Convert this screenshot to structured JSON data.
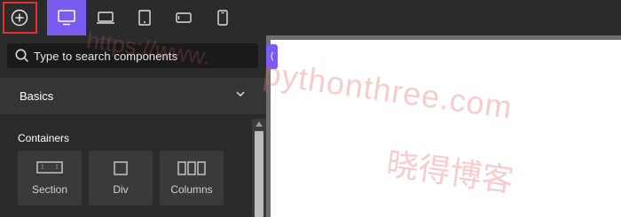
{
  "toolbar": {
    "add_icon": "plus-circle-icon",
    "devices": [
      {
        "name": "desktop",
        "icon": "monitor-icon",
        "active": true
      },
      {
        "name": "laptop",
        "icon": "laptop-icon",
        "active": false
      },
      {
        "name": "tablet",
        "icon": "tablet-icon",
        "active": false
      },
      {
        "name": "mobile-landscape",
        "icon": "mobile-landscape-icon",
        "active": false
      },
      {
        "name": "mobile",
        "icon": "mobile-icon",
        "active": false
      }
    ],
    "accent_color": "#7b5cf0",
    "highlight_color": "#e53030"
  },
  "search": {
    "placeholder": "Type to search components"
  },
  "panel": {
    "section_title": "Basics",
    "group_title": "Containers",
    "blocks": [
      {
        "label": "Section",
        "icon": "section-icon"
      },
      {
        "label": "Div",
        "icon": "div-icon"
      },
      {
        "label": "Columns",
        "icon": "columns-icon"
      }
    ]
  },
  "canvas": {
    "collapse_glyph": "⟨"
  },
  "watermark": {
    "url": "pythonthree.com",
    "site_name": "晓得博客",
    "url_faint": "https://www."
  }
}
